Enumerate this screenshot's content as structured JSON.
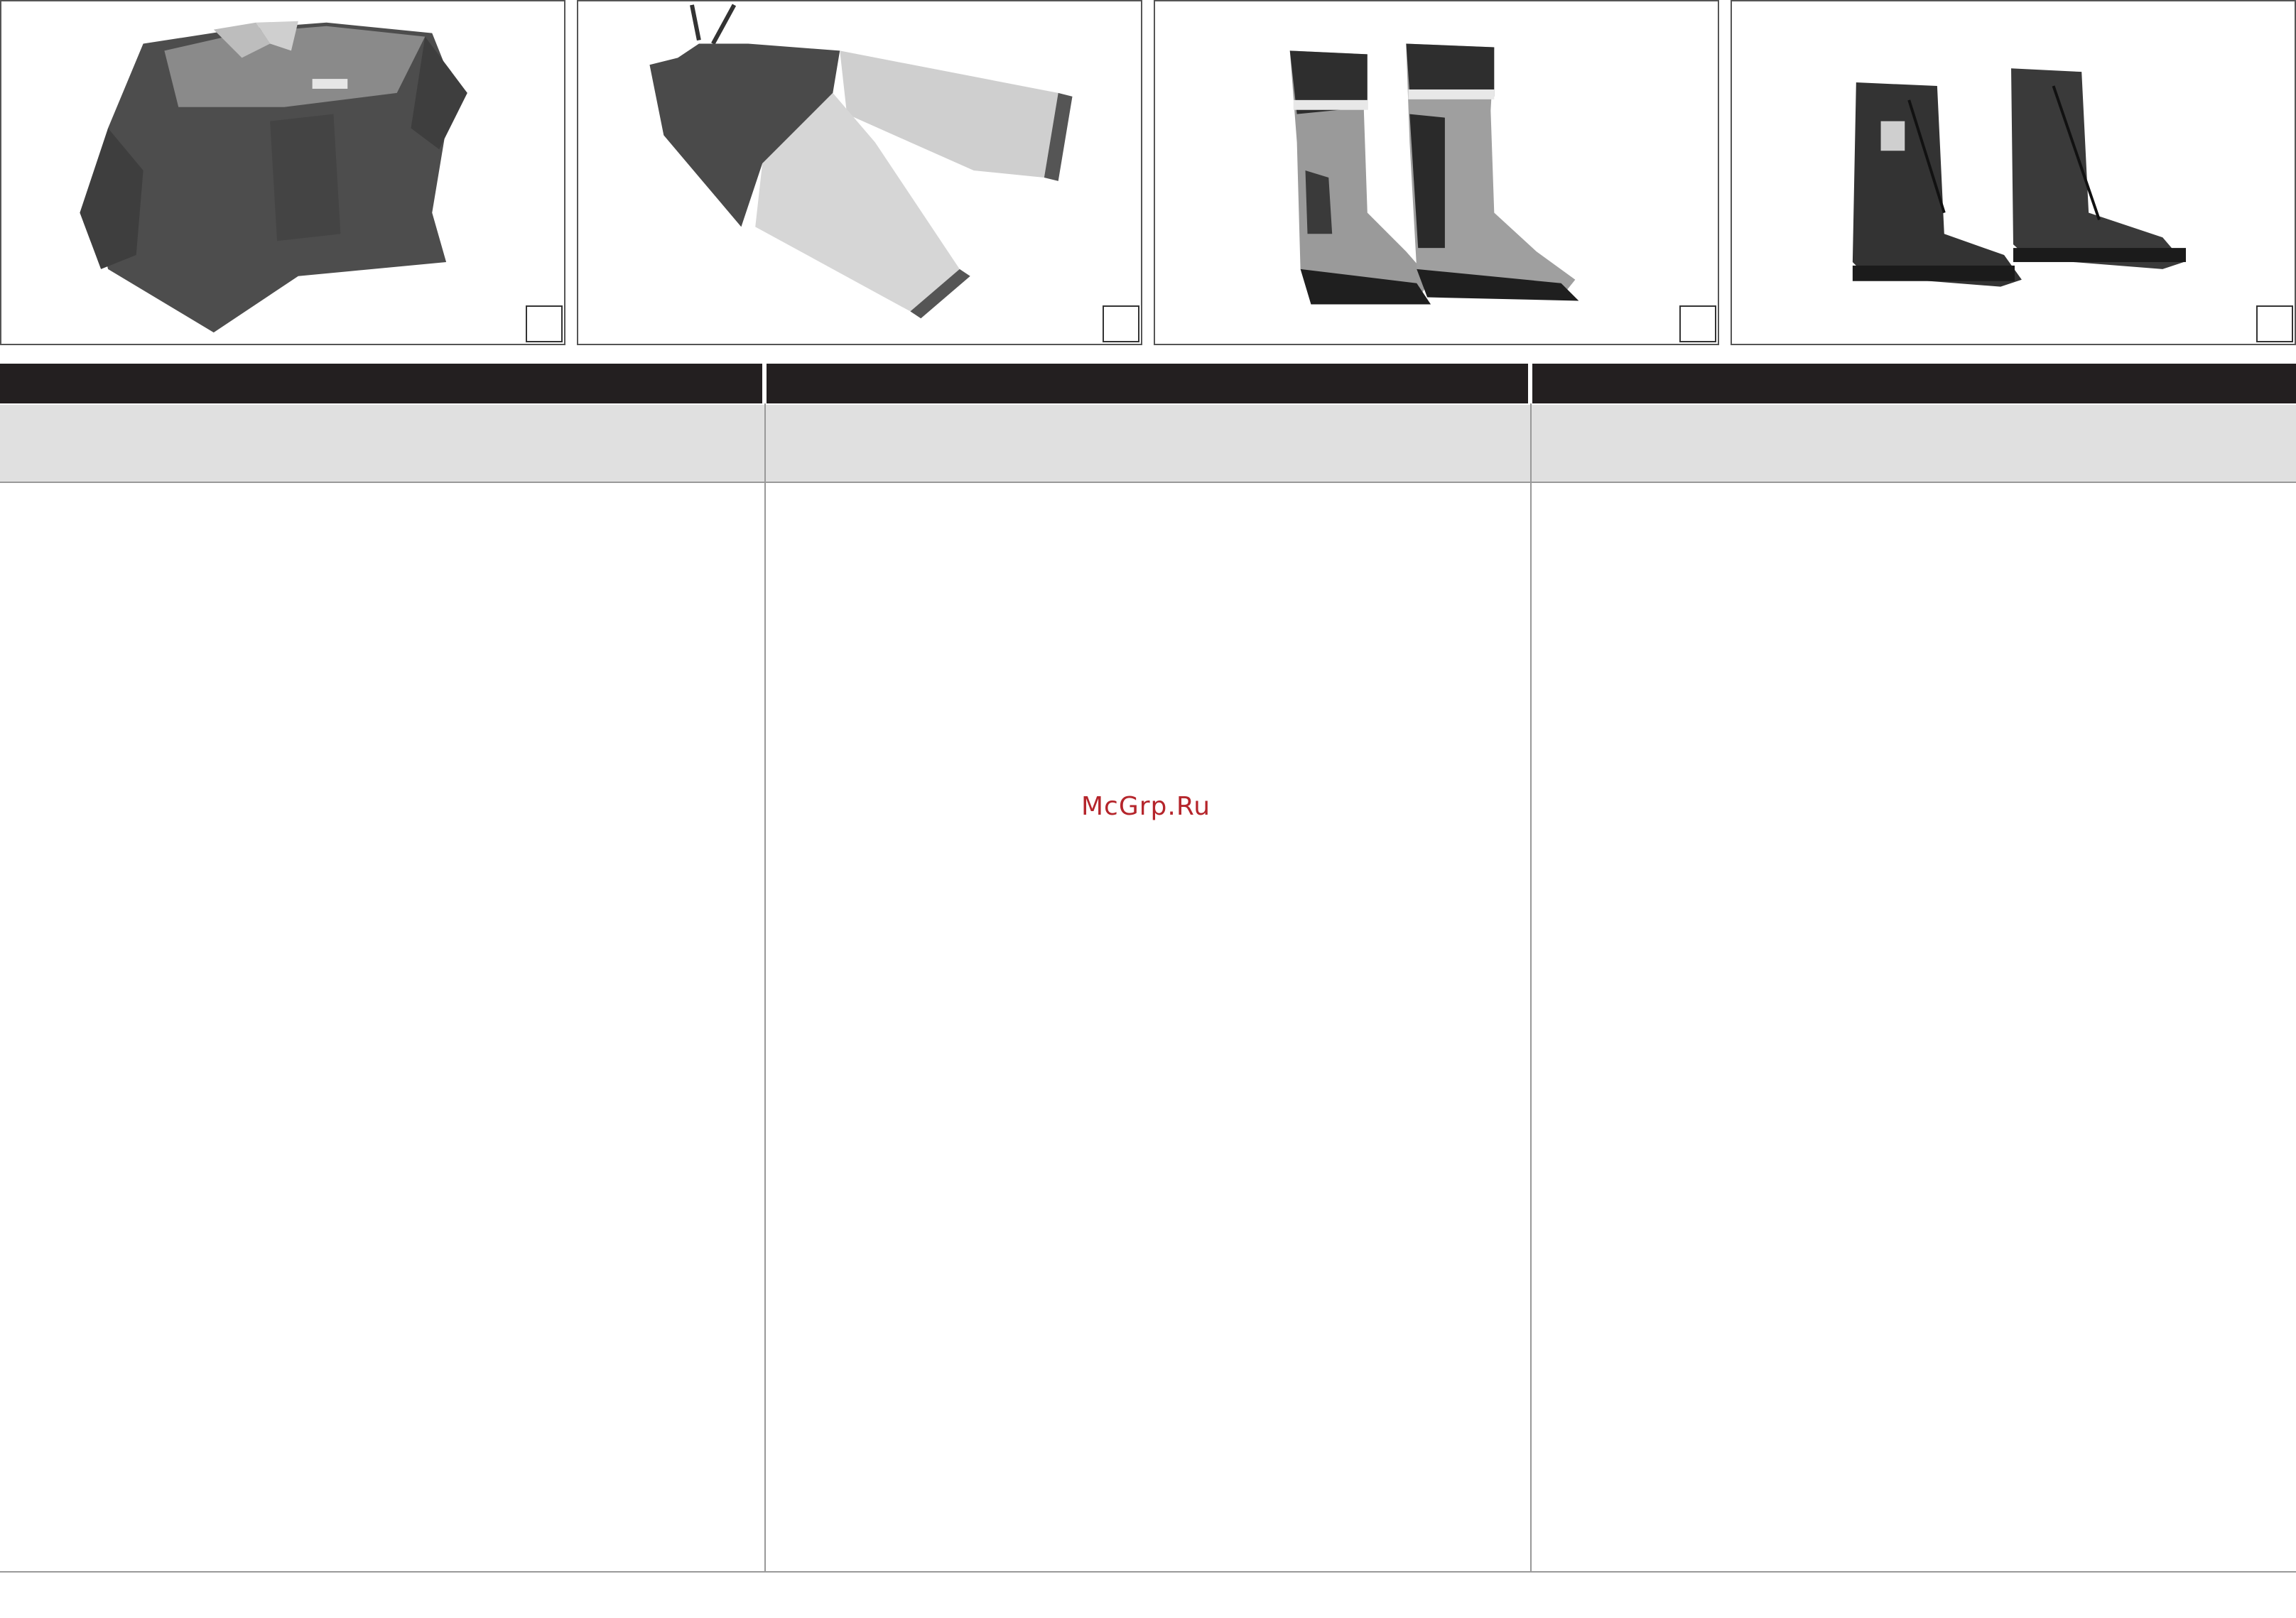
{
  "watermark": {
    "text": "McGrp.Ru",
    "color": "#b5252b"
  },
  "panels": [
    {
      "name": "jacket",
      "icon": "jacket-image"
    },
    {
      "name": "trousers",
      "icon": "bib-trousers-image"
    },
    {
      "name": "rubber-boots",
      "icon": "rubber-boots-image"
    },
    {
      "name": "leather-boots",
      "icon": "leather-boots-image"
    }
  ],
  "table": {
    "columns": [
      {
        "header": "",
        "subheader": "",
        "body": ""
      },
      {
        "header": "",
        "subheader": "",
        "body": ""
      },
      {
        "header": "",
        "subheader": "",
        "body": ""
      }
    ]
  },
  "colors": {
    "header_bar": "#231f20",
    "subheader": "#e0e0e0",
    "border": "#999999"
  }
}
